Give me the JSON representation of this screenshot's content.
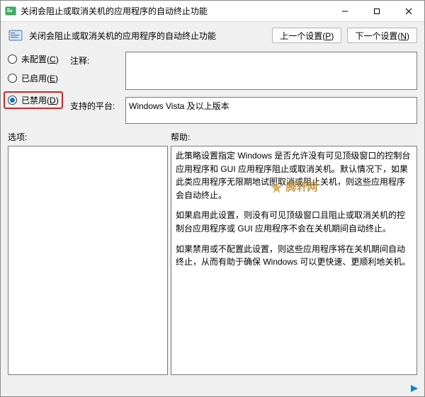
{
  "titlebar": {
    "title": "关闭会阻止或取消关机的应用程序的自动终止功能"
  },
  "header": {
    "title": "关闭会阻止或取消关机的应用程序的自动终止功能",
    "prev_label": "上一个设置",
    "prev_shortcut": "P",
    "next_label": "下一个设置",
    "next_shortcut": "N"
  },
  "radios": {
    "not_configured": {
      "label": "未配置",
      "shortcut": "C",
      "selected": false
    },
    "enabled": {
      "label": "已启用",
      "shortcut": "E",
      "selected": false
    },
    "disabled": {
      "label": "已禁用",
      "shortcut": "D",
      "selected": true
    }
  },
  "fields": {
    "notes_label": "注释:",
    "notes_value": "",
    "platform_label": "支持的平台:",
    "platform_value": "Windows Vista 及以上版本"
  },
  "panel_labels": {
    "options": "选项:",
    "help": "帮助:"
  },
  "help_text": {
    "p1": "此策略设置指定 Windows 是否允许没有可见顶级窗口的控制台应用程序和 GUI 应用程序阻止或取消关机。默认情况下，如果此类应用程序无限期地试图取消或阻止关机，则这些应用程序会自动终止。",
    "p2": "如果启用此设置，则没有可见顶级窗口且阻止或取消关机的控制台应用程序或 GUI 应用程序不会在关机期间自动终止。",
    "p3": "如果禁用或不配置此设置，则这些应用程序将在关机期间自动终止，从而有助于确保 Windows 可以更快速、更顺利地关机。"
  },
  "watermark": {
    "text": "腾轩网"
  }
}
